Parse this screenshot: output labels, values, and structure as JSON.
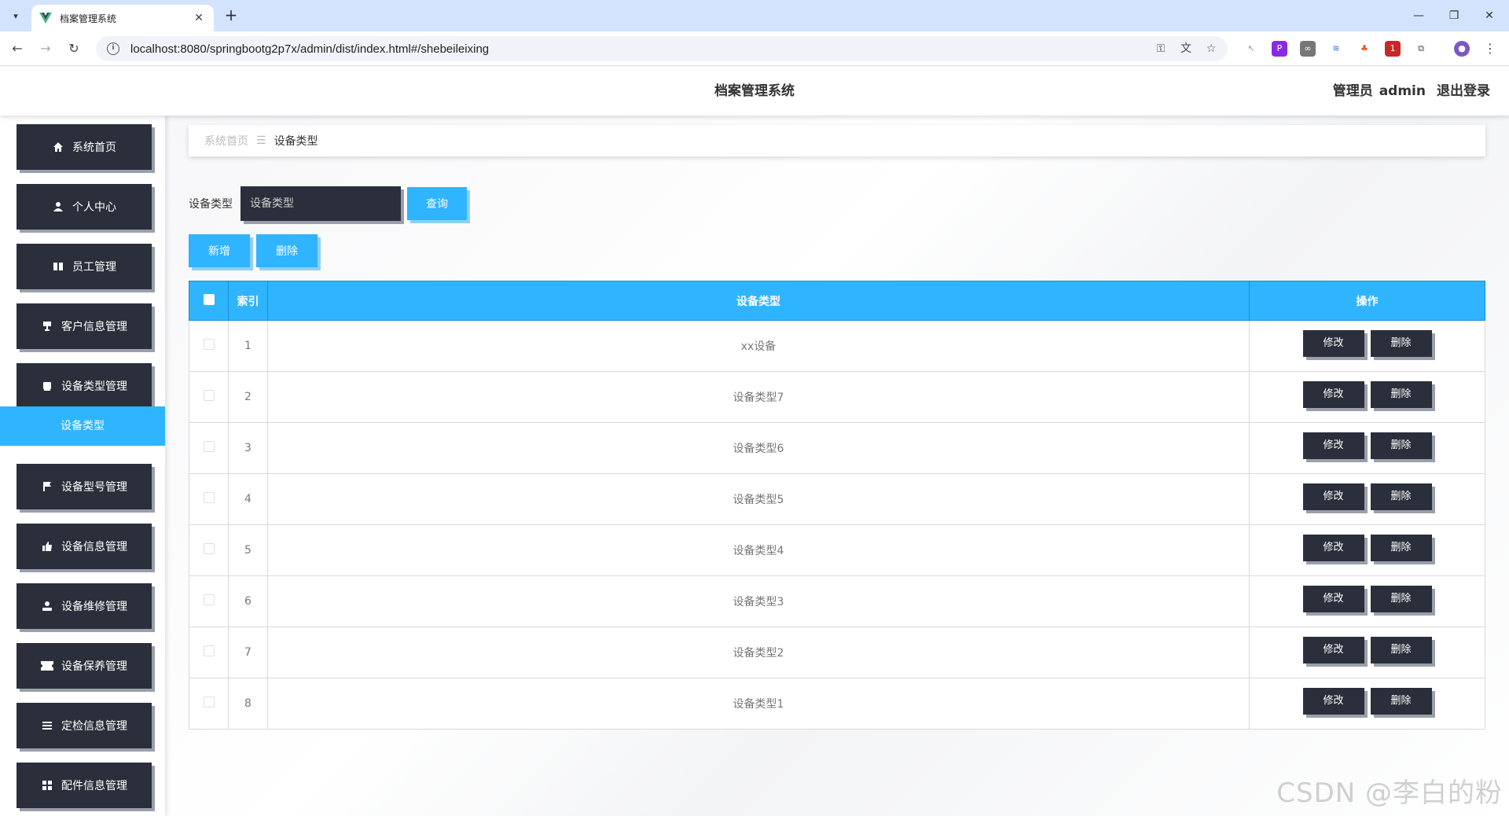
{
  "browser": {
    "tab_title": "档案管理系统",
    "url": "localhost:8080/springbootg2p7x/admin/dist/index.html#/shebeileixing"
  },
  "header": {
    "title": "档案管理系统",
    "user_label": "管理员",
    "username": "admin",
    "logout": "退出登录"
  },
  "sidebar": {
    "items": [
      {
        "label": "系统首页",
        "icon": "home-icon"
      },
      {
        "label": "个人中心",
        "icon": "user-icon"
      },
      {
        "label": "员工管理",
        "icon": "book-icon"
      },
      {
        "label": "客户信息管理",
        "icon": "cup-icon"
      },
      {
        "label": "设备类型管理",
        "icon": "box-icon"
      },
      {
        "label": "设备型号管理",
        "icon": "flag-icon"
      },
      {
        "label": "设备信息管理",
        "icon": "thumb-icon"
      },
      {
        "label": "设备维修管理",
        "icon": "person-icon"
      },
      {
        "label": "设备保养管理",
        "icon": "ticket-icon"
      },
      {
        "label": "定检信息管理",
        "icon": "list-icon"
      },
      {
        "label": "配件信息管理",
        "icon": "grid-icon"
      }
    ],
    "active_sub": "设备类型"
  },
  "breadcrumb": {
    "home": "系统首页",
    "current": "设备类型"
  },
  "search": {
    "label": "设备类型",
    "placeholder": "设备类型",
    "query_button": "查询"
  },
  "actions": {
    "add": "新增",
    "delete": "删除"
  },
  "table": {
    "headers": {
      "index": "索引",
      "type": "设备类型",
      "ops": "操作"
    },
    "edit_label": "修改",
    "delete_label": "删除",
    "rows": [
      {
        "index": "1",
        "type": "xx设备"
      },
      {
        "index": "2",
        "type": "设备类型7"
      },
      {
        "index": "3",
        "type": "设备类型6"
      },
      {
        "index": "4",
        "type": "设备类型5"
      },
      {
        "index": "5",
        "type": "设备类型4"
      },
      {
        "index": "6",
        "type": "设备类型3"
      },
      {
        "index": "7",
        "type": "设备类型2"
      },
      {
        "index": "8",
        "type": "设备类型1"
      }
    ]
  },
  "watermark": "CSDN @李白的粉",
  "colors": {
    "accent": "#2fb4ff",
    "dark": "#2a2f3b"
  }
}
